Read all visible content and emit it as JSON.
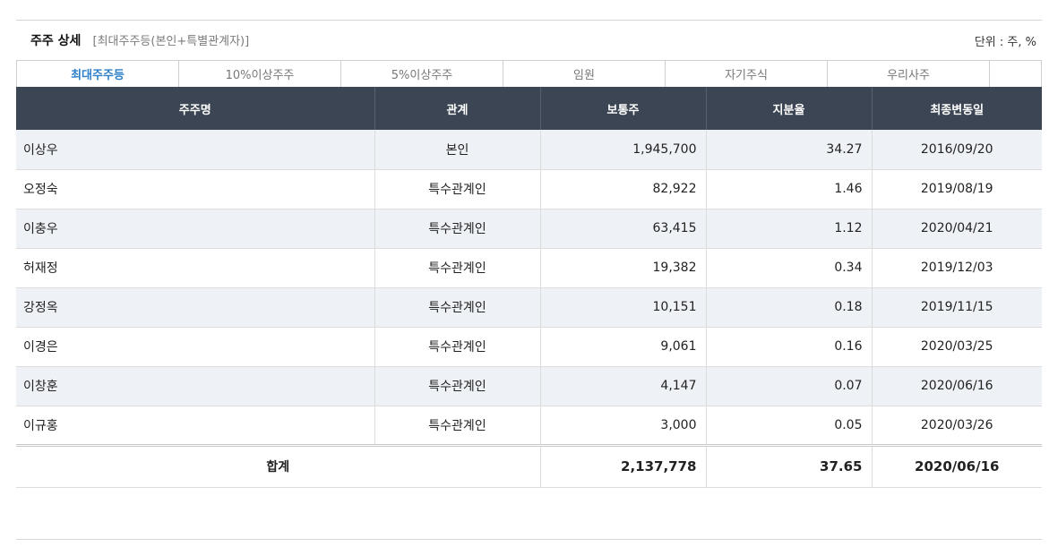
{
  "header": {
    "title": "주주 상세",
    "subtitle": "[최대주주등(본인+특별관계자)]",
    "unit": "단위 : 주, %"
  },
  "tabs": [
    {
      "label": "최대주주등",
      "active": true
    },
    {
      "label": "10%이상주주",
      "active": false
    },
    {
      "label": "5%이상주주",
      "active": false
    },
    {
      "label": "임원",
      "active": false
    },
    {
      "label": "자기주식",
      "active": false
    },
    {
      "label": "우리사주",
      "active": false
    }
  ],
  "table": {
    "columns": [
      "주주명",
      "관계",
      "보통주",
      "지분율",
      "최종변동일"
    ],
    "rows": [
      {
        "name": "이상우",
        "relation": "본인",
        "shares": "1,945,700",
        "ratio": "34.27",
        "date": "2016/09/20"
      },
      {
        "name": "오정숙",
        "relation": "특수관계인",
        "shares": "82,922",
        "ratio": "1.46",
        "date": "2019/08/19"
      },
      {
        "name": "이충우",
        "relation": "특수관계인",
        "shares": "63,415",
        "ratio": "1.12",
        "date": "2020/04/21"
      },
      {
        "name": "허재정",
        "relation": "특수관계인",
        "shares": "19,382",
        "ratio": "0.34",
        "date": "2019/12/03"
      },
      {
        "name": "강정옥",
        "relation": "특수관계인",
        "shares": "10,151",
        "ratio": "0.18",
        "date": "2019/11/15"
      },
      {
        "name": "이경은",
        "relation": "특수관계인",
        "shares": "9,061",
        "ratio": "0.16",
        "date": "2020/03/25"
      },
      {
        "name": "이창훈",
        "relation": "특수관계인",
        "shares": "4,147",
        "ratio": "0.07",
        "date": "2020/06/16"
      },
      {
        "name": "이규홍",
        "relation": "특수관계인",
        "shares": "3,000",
        "ratio": "0.05",
        "date": "2020/03/26"
      }
    ],
    "total": {
      "label": "합계",
      "shares": "2,137,778",
      "ratio": "37.65",
      "date": "2020/06/16"
    }
  },
  "colors": {
    "header_bg": "#3b4553",
    "active_tab": "#2c7fc9",
    "stripe": "#eef1f6"
  }
}
